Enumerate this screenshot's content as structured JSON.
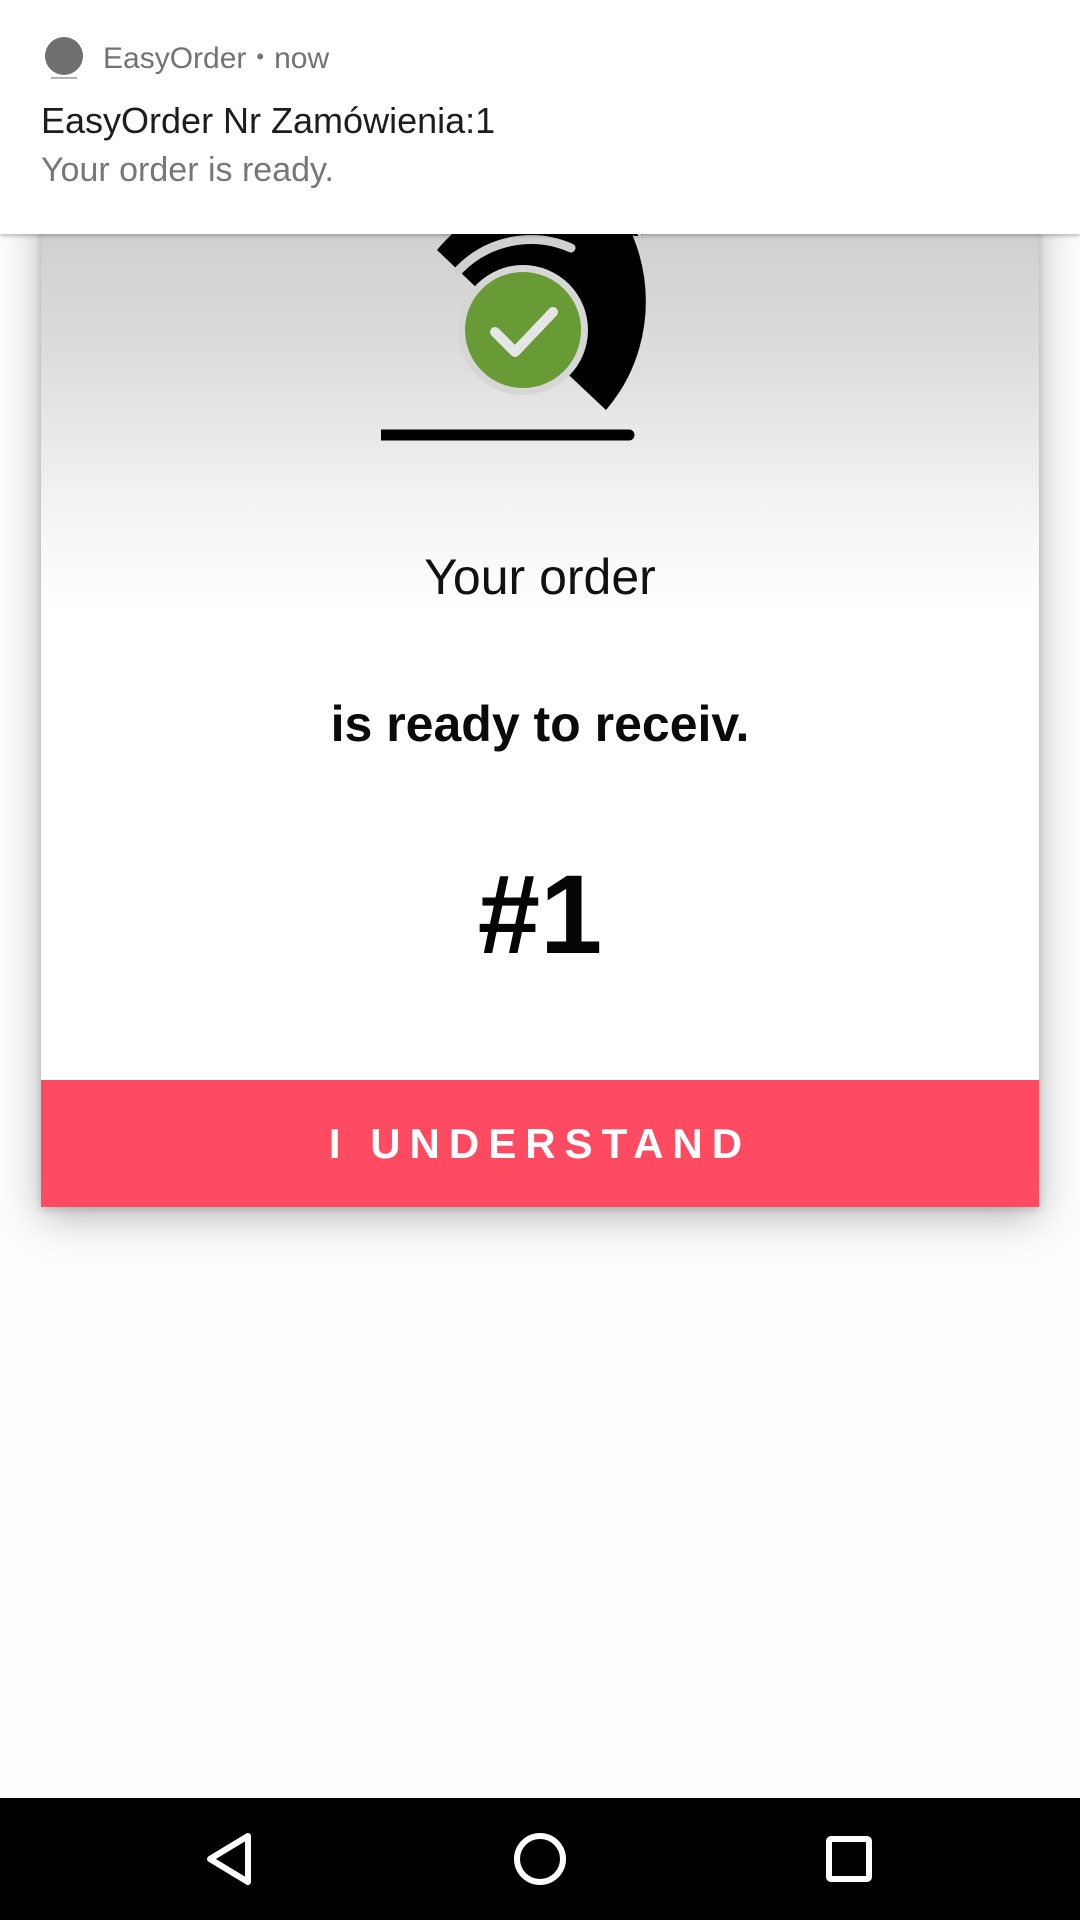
{
  "notification": {
    "app_name": "EasyOrder",
    "separator": "•",
    "time": "now",
    "title": "EasyOrder Nr Zamówienia:1",
    "text": "Your order is ready.",
    "app_icon": "app-logo-icon"
  },
  "card": {
    "icon": "order-ready-bell-check-icon",
    "line1": "Your order",
    "line2": "is ready to receiv.",
    "order_number": "#1",
    "button_label": "I UNDERSTAND"
  },
  "nav": {
    "back_icon": "back-icon",
    "home_icon": "home-icon",
    "recents_icon": "recents-icon"
  },
  "colors": {
    "accent": "#ff4b62",
    "check_green": "#689b35",
    "nav_bg": "#000000"
  }
}
